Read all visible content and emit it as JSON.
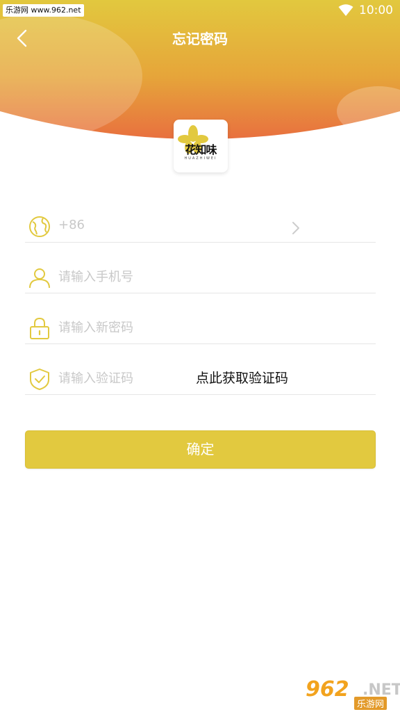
{
  "status_bar": {
    "watermark": "乐游网 www.962.net",
    "time": "10:00"
  },
  "header": {
    "title": "忘记密码",
    "gradient_top": "#e3c83f",
    "gradient_bottom": "#e8703e"
  },
  "logo": {
    "text": "花知味",
    "subtext": "HUAZHIWEI"
  },
  "form": {
    "country_code": "+86",
    "phone_placeholder": "请输入手机号",
    "password_placeholder": "请输入新密码",
    "code_placeholder": "请输入验证码",
    "get_code_label": "点此获取验证码",
    "icon_color": "#e2c93f"
  },
  "actions": {
    "confirm_label": "确定",
    "confirm_color": "#e2c93f"
  },
  "watermark_bottom": {
    "number": "962",
    "suffix": ".NET",
    "cn": "乐游网"
  }
}
